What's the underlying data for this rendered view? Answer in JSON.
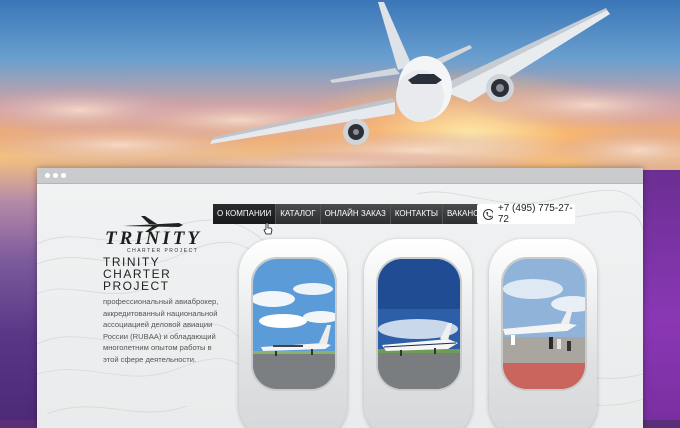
{
  "brand": {
    "logo_text": "TRINITY",
    "logo_subtext": "CHARTER PROJECT"
  },
  "nav": {
    "items": [
      {
        "label": "О КОМПАНИИ",
        "active": true
      },
      {
        "label": "КАТАЛОГ",
        "active": false
      },
      {
        "label": "ОНЛАЙН ЗАКАЗ",
        "active": false
      },
      {
        "label": "КОНТАКТЫ",
        "active": false
      },
      {
        "label": "ВАКАНСИИ",
        "active": false
      }
    ]
  },
  "phone": {
    "number": "+7 (495) 775-27-72",
    "icon": "phone-icon"
  },
  "intro": {
    "title_lines": [
      "TRINITY",
      "CHARTER",
      "PROJECT"
    ],
    "description": "профессиональный авиаброкер, аккредитованный национальной ассоциацией деловой авиации России (RUBAA) и обладающий многолетним опытом работы в этой сфере деятельности."
  },
  "colors": {
    "nav_bg": "#2c2e30",
    "page_bg": "#eef0f1",
    "sky_sunset": "#f2b070"
  }
}
